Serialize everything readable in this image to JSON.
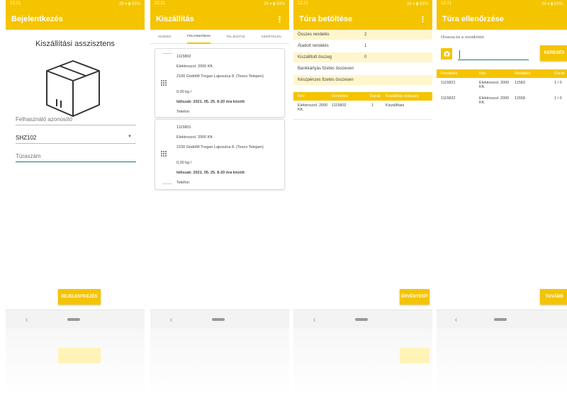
{
  "status_time": "12:21",
  "status_right": "36 ▾ ▮ 83%",
  "screen1": {
    "title": "Bejelentkezés",
    "heading": "Kiszállítási asszisztens",
    "user_placeholder": "Felhasználó azonosító",
    "device_value": "SHZ102",
    "tour_placeholder": "Túraszám",
    "login_button": "BEJELENTKEZÉS"
  },
  "screen2": {
    "title": "Kiszállítás",
    "more": "⋮",
    "tabs": [
      "KEZDÉS",
      "FOLYAMATBAN",
      "TELJESÍTVE",
      "SIKERTELEN"
    ],
    "cards": [
      {
        "order": "1115802",
        "recipient": "Elektroszol. 2000 Kft.",
        "address": "2100 Gödöllő Tregan Lajosutca 8. (Tesco Telepen)",
        "weight": "0,00 kg /",
        "slot": "Időszak: 2021. 05. 25. 8-20 óra között",
        "phone": "Telefon:"
      },
      {
        "order": "1115801",
        "recipient": "Elektroszol. 2000 Kft.",
        "address": "2100 Gödöllő Tregan Lajosutca 8. (Tesco Telepen)",
        "weight": "0,00 kg /",
        "slot": "Időszak: 2021. 05. 25. 8-20 óra között",
        "phone": "Telefon:"
      }
    ]
  },
  "screen3": {
    "title": "Túra betöltése",
    "more": "⋮",
    "rows": [
      {
        "label": "Összes rendelés",
        "value": "2"
      },
      {
        "label": "Átadott rendelés",
        "value": "1"
      },
      {
        "label": "Kiszállított összeg",
        "value": "0"
      },
      {
        "label": "Bankkártyás fizetés összesen",
        "value": ""
      },
      {
        "label": "Készpénzes fizetés összesen",
        "value": ""
      }
    ],
    "table_headers": [
      "Név",
      "Rendelés",
      "Darab",
      "Kiszállítás státusza"
    ],
    "table_rows": [
      {
        "name": "Elektroszol. 2000 Kft.",
        "order": "1115802",
        "qty": "1",
        "status": "Kiszállítani"
      }
    ],
    "confirm_button": "ÉRVÉNYESÍT"
  },
  "screen4": {
    "title": "Túra ellenőrzése",
    "hint": "Olvassa be a vonalkódot.",
    "search_button": "KERESÉS",
    "table_headers": [
      "Rendelés",
      "Név",
      "Vonalkód",
      "Darab"
    ],
    "table_rows": [
      {
        "order": "1115821",
        "name": "Elektroszol. 2000 Kft.",
        "code": "11583",
        "qty": "1 / 0"
      },
      {
        "order": "1115822",
        "name": "Elektroszol. 2000 Kft.",
        "code": "11558",
        "qty": "1 / 0"
      }
    ],
    "next_button": "TOVÁBB"
  },
  "colors": {
    "accent": "#f5c400",
    "teal": "#0f7b6c"
  }
}
